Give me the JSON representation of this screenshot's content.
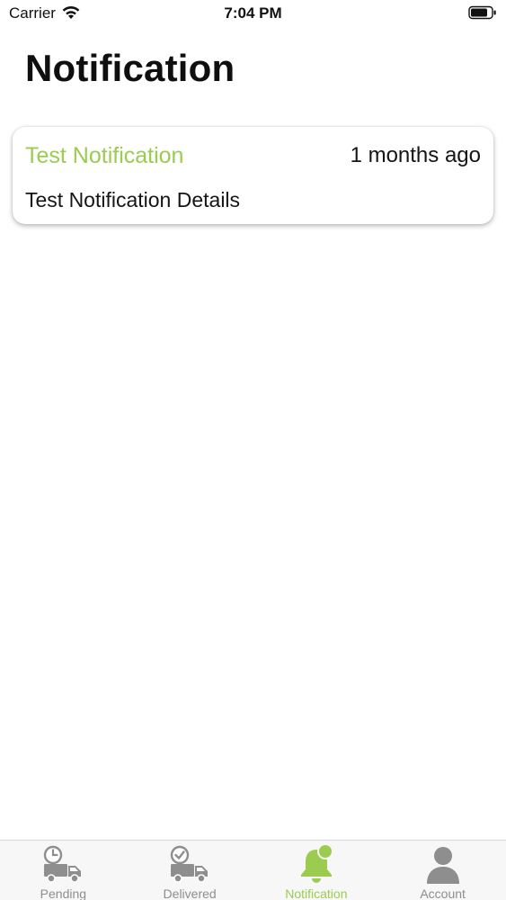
{
  "status_bar": {
    "carrier": "Carrier",
    "time": "7:04 PM",
    "wifi_icon": "wifi-icon",
    "battery_icon": "battery-icon"
  },
  "header": {
    "title": "Notification"
  },
  "notifications": [
    {
      "title": "Test Notification",
      "time_ago": "1 months ago",
      "details": "Test Notification Details"
    }
  ],
  "tab_bar": {
    "tabs": [
      {
        "label": "Pending",
        "icon": "truck-clock-icon",
        "active": false
      },
      {
        "label": "Delivered",
        "icon": "truck-check-icon",
        "active": false
      },
      {
        "label": "Notification",
        "icon": "bell-icon",
        "active": true
      },
      {
        "label": "Account",
        "icon": "user-icon",
        "active": false
      }
    ]
  },
  "colors": {
    "accent": "#9ccc4f",
    "inactive": "#8e8e8e",
    "text": "#111111",
    "background": "#ffffff"
  }
}
